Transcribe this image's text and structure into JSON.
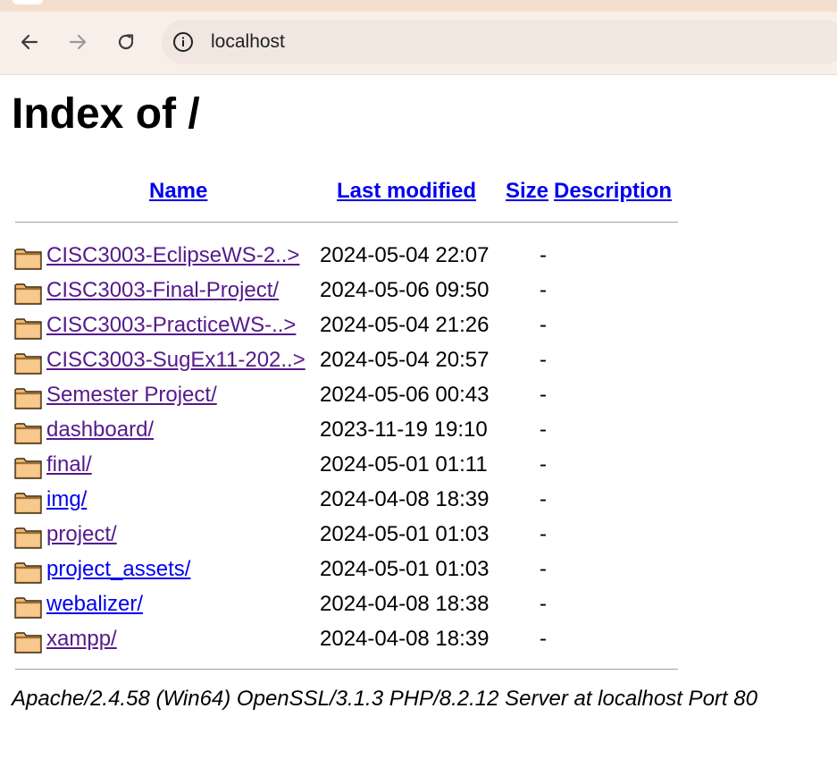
{
  "browser": {
    "url": "localhost"
  },
  "page": {
    "title": "Index of /",
    "columns": {
      "name": "Name",
      "last_modified": "Last modified",
      "size": "Size",
      "description": "Description"
    },
    "rows": [
      {
        "name": "CISC3003-EclipseWS-2..>",
        "modified": "2024-05-04 22:07",
        "size": "-",
        "visited": true
      },
      {
        "name": "CISC3003-Final-Project/",
        "modified": "2024-05-06 09:50",
        "size": "-",
        "visited": true
      },
      {
        "name": "CISC3003-PracticeWS-..>",
        "modified": "2024-05-04 21:26",
        "size": "-",
        "visited": true
      },
      {
        "name": "CISC3003-SugEx11-202..>",
        "modified": "2024-05-04 20:57",
        "size": "-",
        "visited": true
      },
      {
        "name": "Semester Project/",
        "modified": "2024-05-06 00:43",
        "size": "-",
        "visited": true
      },
      {
        "name": "dashboard/",
        "modified": "2023-11-19 19:10",
        "size": "-",
        "visited": true
      },
      {
        "name": "final/",
        "modified": "2024-05-01 01:11",
        "size": "-",
        "visited": true
      },
      {
        "name": "img/",
        "modified": "2024-04-08 18:39",
        "size": "-",
        "visited": false
      },
      {
        "name": "project/",
        "modified": "2024-05-01 01:03",
        "size": "-",
        "visited": true
      },
      {
        "name": "project_assets/",
        "modified": "2024-05-01 01:03",
        "size": "-",
        "visited": false
      },
      {
        "name": "webalizer/",
        "modified": "2024-04-08 18:38",
        "size": "-",
        "visited": false
      },
      {
        "name": "xampp/",
        "modified": "2024-04-08 18:39",
        "size": "-",
        "visited": true
      }
    ],
    "footer": "Apache/2.4.58 (Win64) OpenSSL/3.1.3 PHP/8.2.12 Server at localhost Port 80"
  },
  "colors": {
    "link": "#0000ee",
    "visited_link": "#551a8b",
    "toolbar_bg": "#f8efe9",
    "omnibox_bg": "#f1e7e0"
  },
  "icons": [
    "back-arrow-icon",
    "forward-arrow-icon",
    "reload-icon",
    "info-icon",
    "folder-icon"
  ]
}
